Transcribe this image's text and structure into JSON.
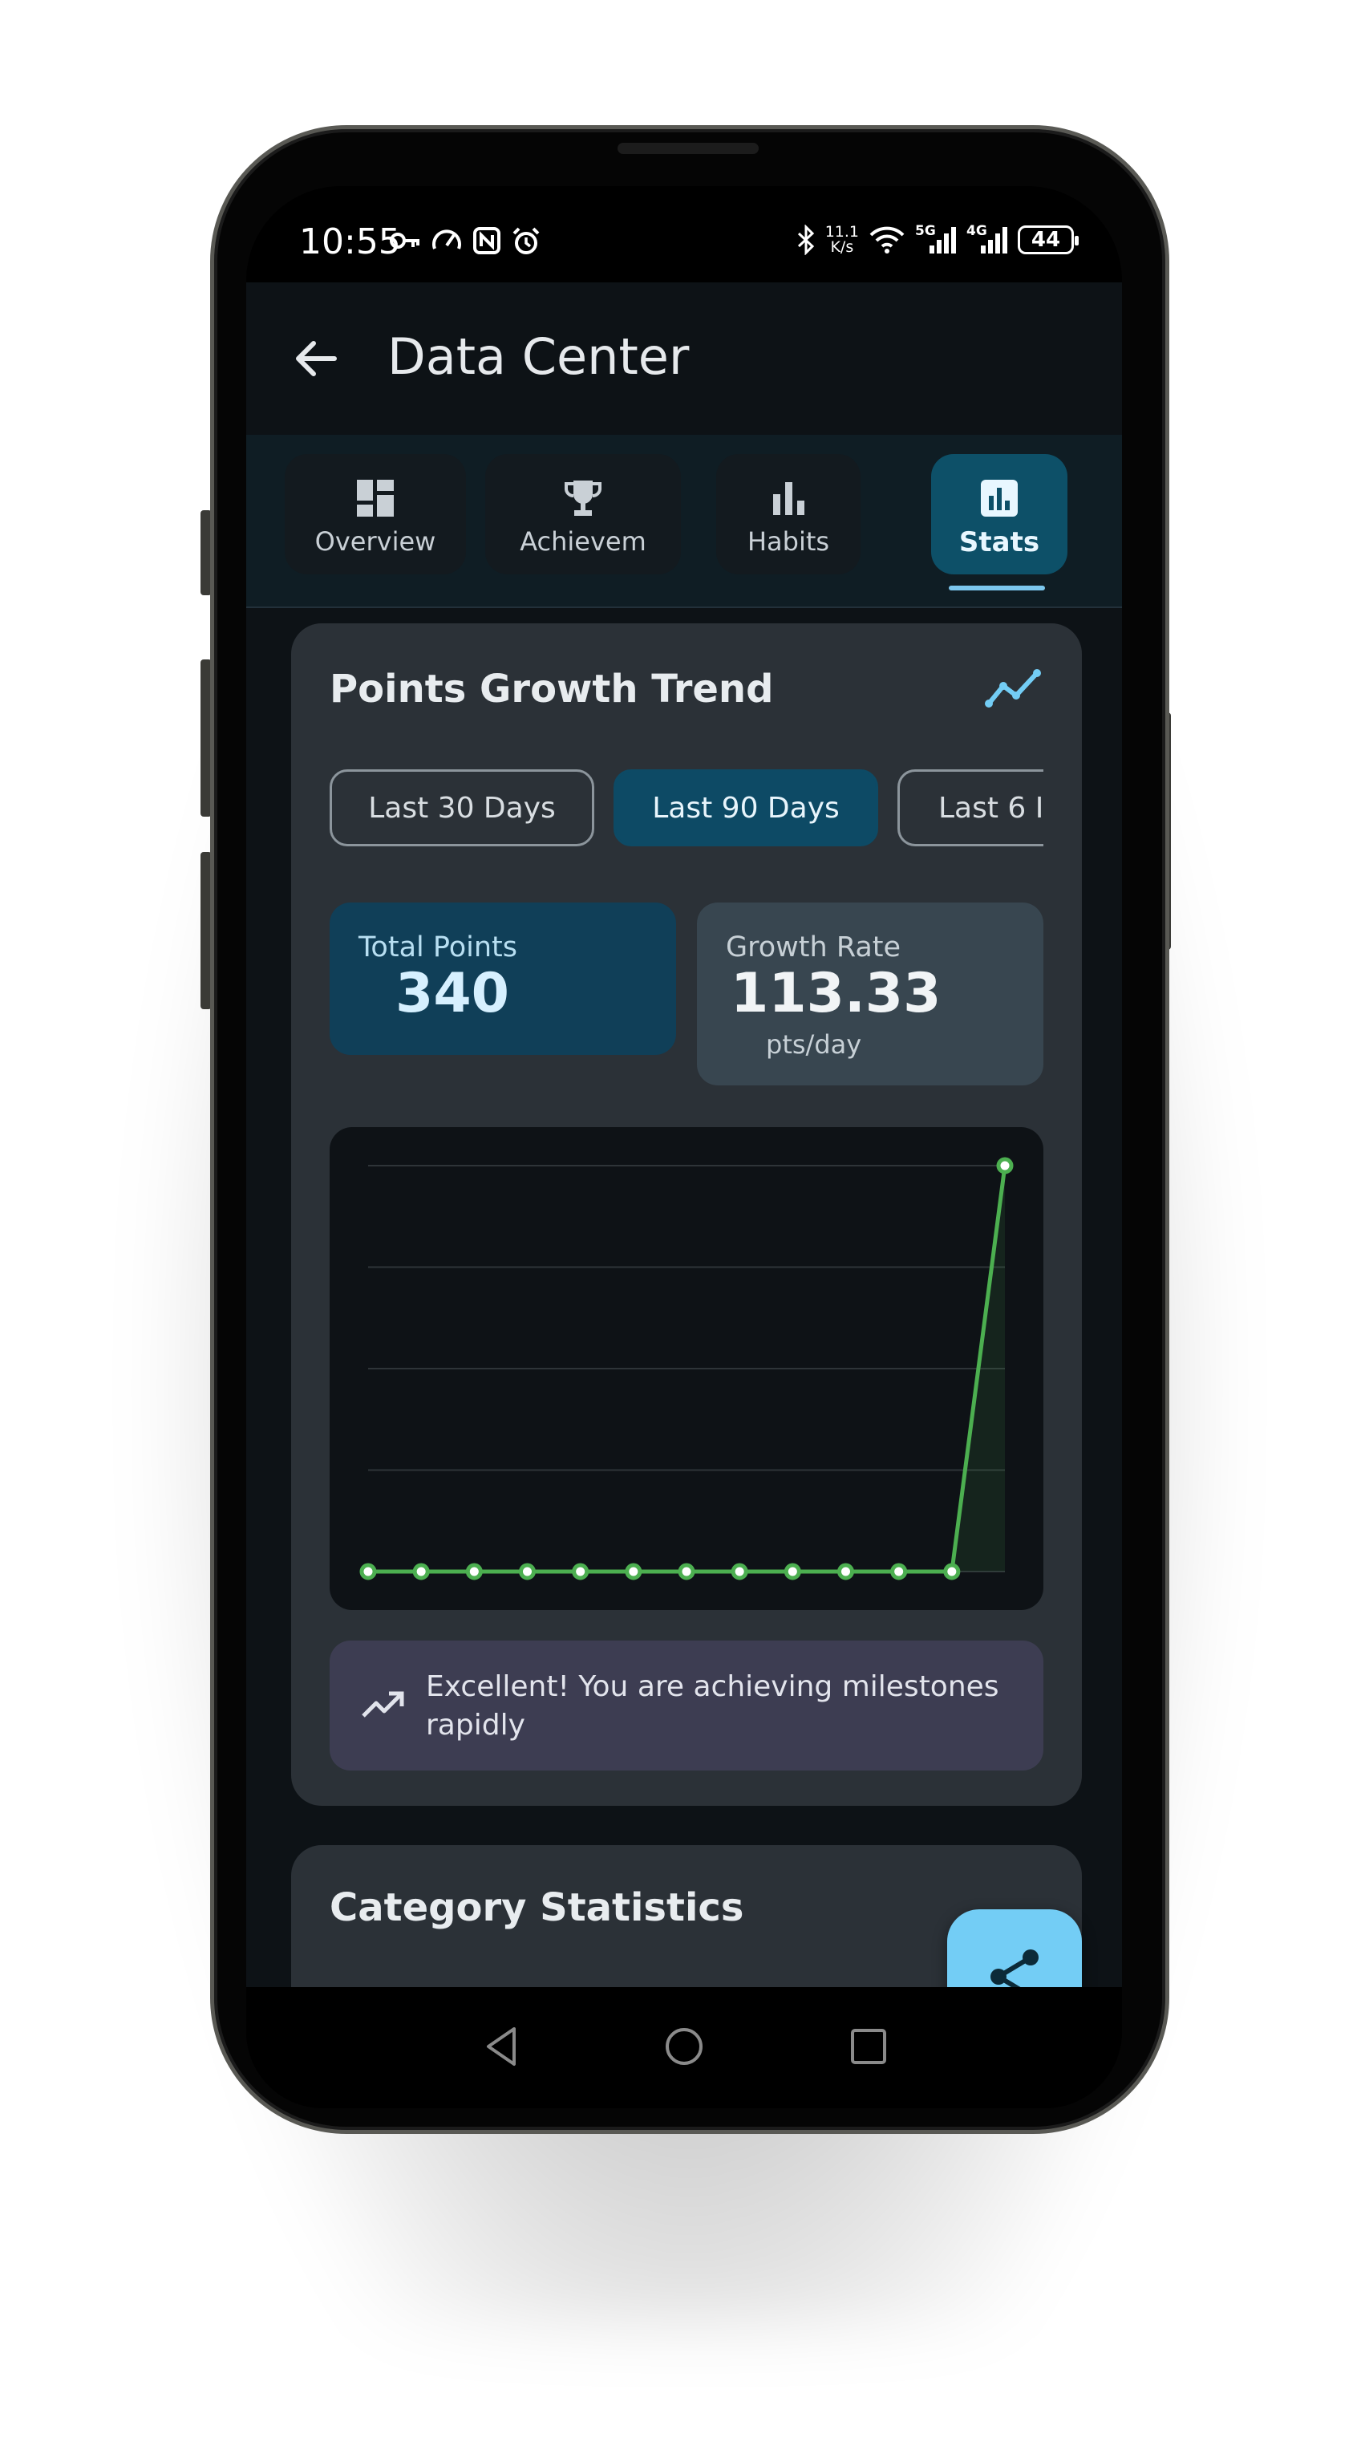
{
  "status_bar": {
    "time": "10:55",
    "net_speed_top": "11.1",
    "net_speed_bottom": "K/s",
    "net_5g": "5G",
    "net_4g": "4G",
    "battery": "44"
  },
  "header": {
    "title": "Data Center"
  },
  "tabs": [
    {
      "label": "Overview",
      "icon": "dashboard-icon",
      "active": false
    },
    {
      "label": "Achievem",
      "icon": "trophy-icon",
      "active": false
    },
    {
      "label": "Habits",
      "icon": "bar-chart-icon",
      "active": false
    },
    {
      "label": "Stats",
      "icon": "stats-icon",
      "active": true
    }
  ],
  "trend_card": {
    "title": "Points Growth Trend",
    "icon": "trend-line-icon",
    "chips": [
      {
        "label": "Last 30 Days",
        "selected": false
      },
      {
        "label": "Last 90 Days",
        "selected": true
      },
      {
        "label": "Last 6 I",
        "selected": false
      }
    ],
    "total_points": {
      "label": "Total Points",
      "value": "340"
    },
    "growth_rate": {
      "label": "Growth Rate",
      "value": "113.33",
      "unit": "pts/day"
    },
    "message": "Excellent! You are achieving milestones rapidly"
  },
  "chart_data": {
    "type": "line",
    "x": [
      1,
      2,
      3,
      4,
      5,
      6,
      7,
      8,
      9,
      10,
      11,
      12,
      13
    ],
    "series": [
      {
        "values": [
          0,
          0,
          0,
          0,
          0,
          0,
          0,
          0,
          0,
          0,
          0,
          0,
          340
        ]
      }
    ],
    "ylim": [
      0,
      340
    ],
    "grid": true,
    "line_color": "#4caf50",
    "point_color": "#4caf50"
  },
  "category_card": {
    "title": "Category Statistics"
  },
  "fab": {
    "icon": "share-icon"
  },
  "colors": {
    "background": "#0d1216",
    "card": "#2b3137",
    "accent": "#73cdf5",
    "selected_tab": "#0d5068",
    "line": "#4caf50"
  }
}
